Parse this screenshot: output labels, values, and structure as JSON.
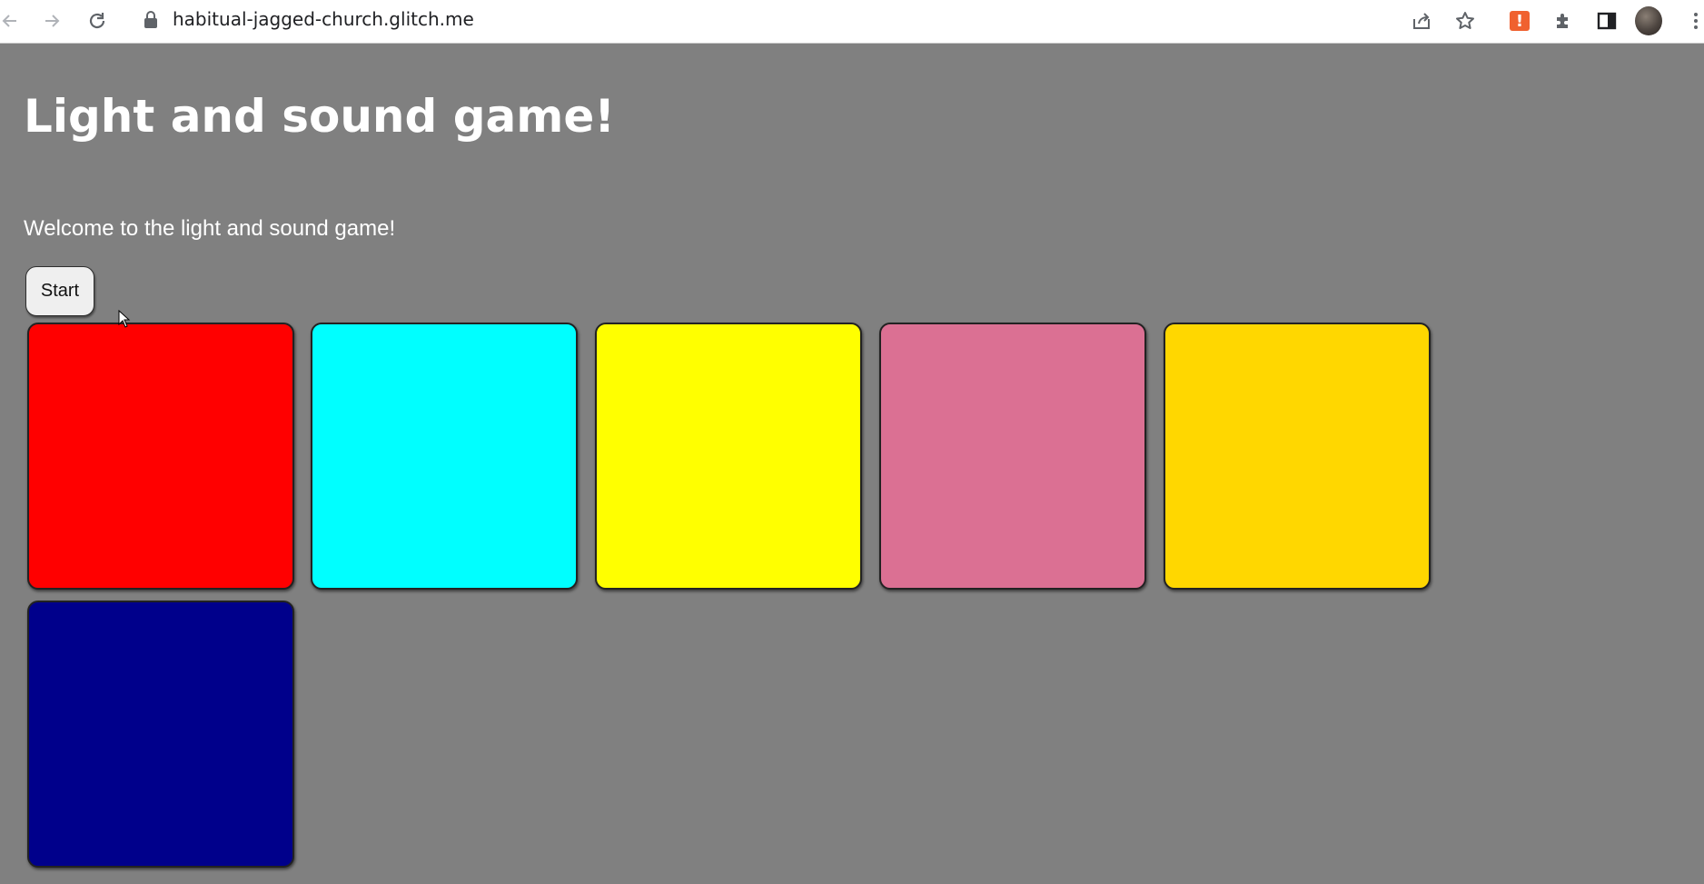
{
  "browser": {
    "url": "habitual-jagged-church.glitch.me",
    "ext_badge": "!"
  },
  "page": {
    "title": "Light and sound game!",
    "welcome": "Welcome to the light and sound game!",
    "start_label": "Start"
  },
  "colors": {
    "background": "#808080",
    "pad1": "#ff0000",
    "pad2": "#00ffff",
    "pad3": "#ffff00",
    "pad4": "#db7093",
    "pad5": "#ffd700",
    "pad6": "#00008b"
  },
  "icons": [
    "back-arrow-icon",
    "forward-arrow-icon",
    "reload-icon",
    "lock-icon",
    "share-icon",
    "bookmark-star-icon",
    "extension-alert-icon",
    "puzzle-extensions-icon",
    "side-panel-icon",
    "profile-avatar",
    "kebab-menu-icon"
  ]
}
